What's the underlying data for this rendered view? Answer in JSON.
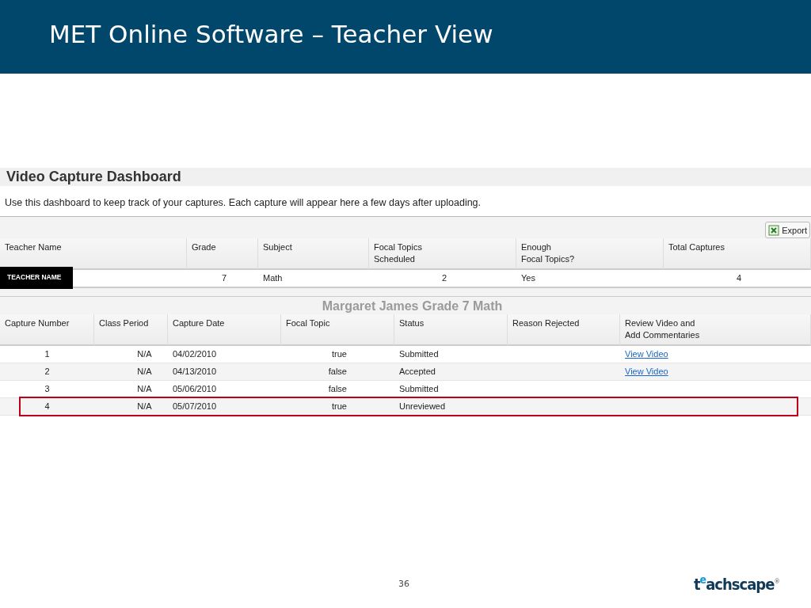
{
  "slide_title": "MET Online Software – Teacher View",
  "dashboard": {
    "title": "Video Capture Dashboard",
    "description": "Use this dashboard to keep track of your captures. Each capture will appear here a few days after uploading.",
    "export_button": "Export",
    "summary": {
      "columns": [
        "Teacher Name",
        "Grade",
        "Subject",
        "Focal Topics\nScheduled",
        "Enough\nFocal Topics?",
        "Total Captures"
      ],
      "row": {
        "teacher_name": "TEACHER NAME",
        "grade": "7",
        "subject": "Math",
        "focal_topics_scheduled": "2",
        "enough": "Yes",
        "total_captures": "4"
      }
    },
    "captures": {
      "title": "Margaret James Grade 7 Math",
      "columns": [
        "Capture Number",
        "Class Period",
        "Capture Date",
        "Focal Topic",
        "Status",
        "Reason Rejected",
        "Review Video and\nAdd Commentaries"
      ],
      "rows": [
        {
          "number": "1",
          "period": "N/A",
          "date": "04/02/2010",
          "focal": "true",
          "status": "Submitted",
          "link": "View Video",
          "highlighted": false
        },
        {
          "number": "2",
          "period": "N/A",
          "date": "04/13/2010",
          "focal": "false",
          "status": "Accepted",
          "link": "View Video",
          "highlighted": false
        },
        {
          "number": "3",
          "period": "N/A",
          "date": "05/06/2010",
          "focal": "false",
          "status": "Submitted",
          "highlighted": false
        },
        {
          "number": "4",
          "period": "N/A",
          "date": "05/07/2010",
          "focal": "true",
          "status": "Unreviewed",
          "highlighted": true
        }
      ]
    }
  },
  "page_number": "36",
  "logo": "t$^{e}$achscape$^{®}$"
}
